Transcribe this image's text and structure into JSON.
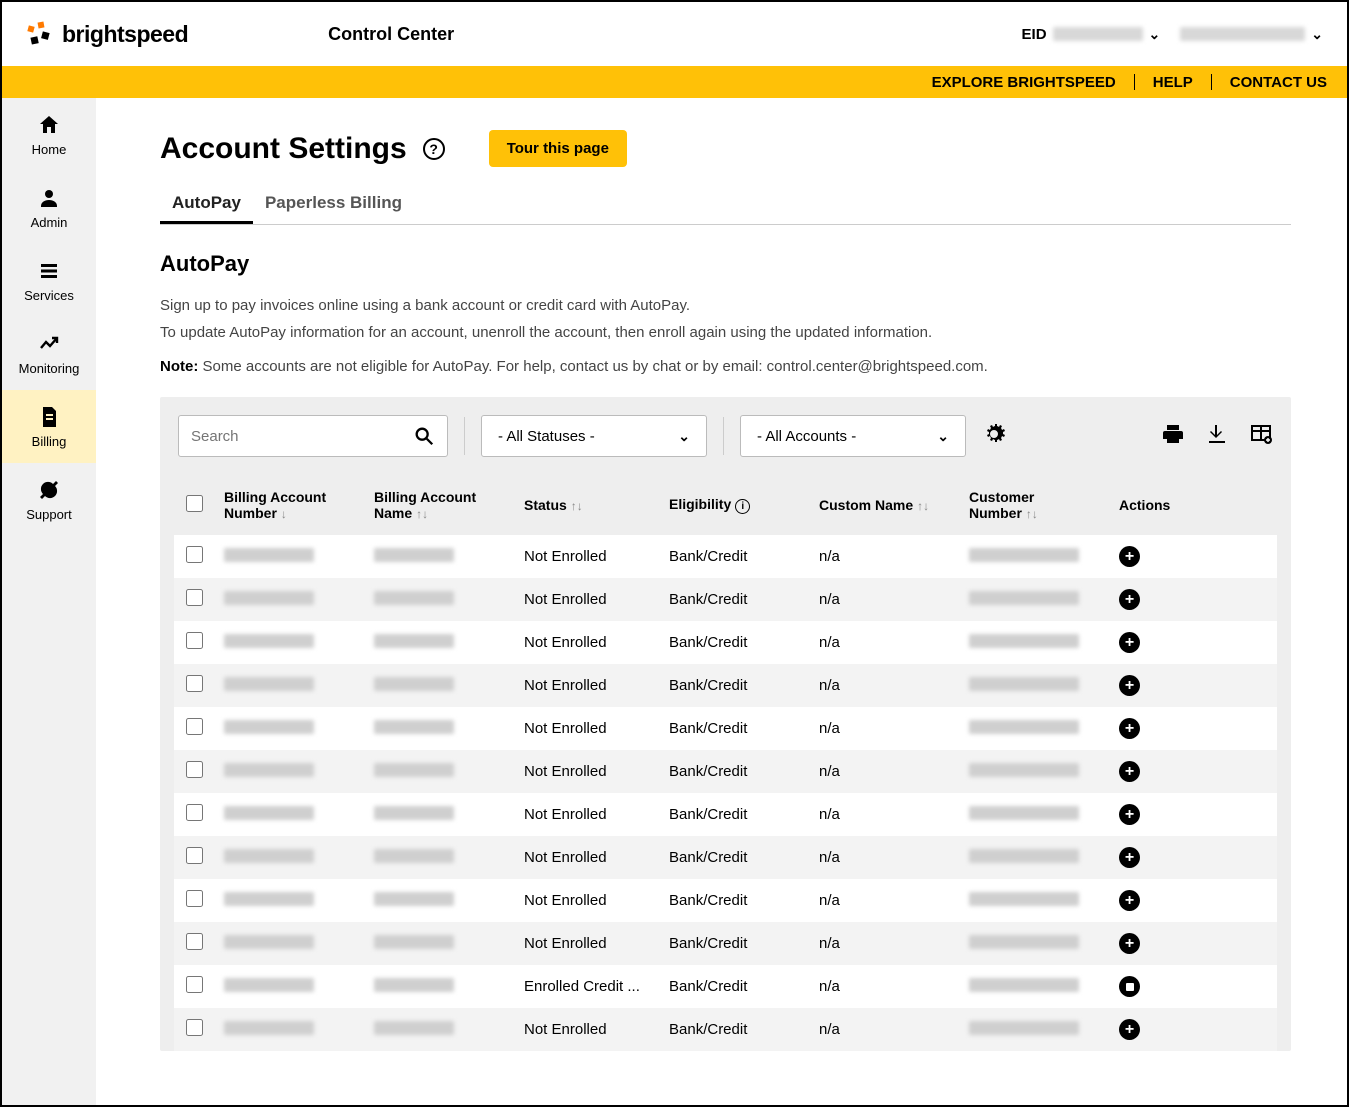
{
  "header": {
    "logo_text": "brightspeed",
    "product": "Control Center",
    "eid_label": "EID"
  },
  "yellowbar": {
    "explore": "EXPLORE BRIGHTSPEED",
    "help": "HELP",
    "contact": "CONTACT US"
  },
  "sidebar": {
    "items": [
      {
        "key": "home",
        "label": "Home"
      },
      {
        "key": "admin",
        "label": "Admin"
      },
      {
        "key": "services",
        "label": "Services"
      },
      {
        "key": "monitoring",
        "label": "Monitoring"
      },
      {
        "key": "billing",
        "label": "Billing"
      },
      {
        "key": "support",
        "label": "Support"
      }
    ]
  },
  "page": {
    "title": "Account Settings",
    "tour_btn": "Tour this page",
    "tabs": {
      "autopay": "AutoPay",
      "paperless": "Paperless Billing"
    },
    "section_title": "AutoPay",
    "desc1": "Sign up to pay invoices online using a bank account or credit card with AutoPay.",
    "desc2": "To update AutoPay information for an account, unenroll the account, then enroll again using the updated information.",
    "note_label": "Note:",
    "note_text": " Some accounts are not eligible for AutoPay. For help, contact us by chat or by email: control.center@brightspeed.com."
  },
  "controls": {
    "search_placeholder": "Search",
    "status_filter": "- All Statuses -",
    "account_filter": "- All Accounts -"
  },
  "columns": {
    "ban": "Billing Account Number",
    "name": "Billing Account Name",
    "status": "Status",
    "elig": "Eligibility",
    "custom": "Custom Name",
    "cust_num": "Customer Number",
    "actions": "Actions"
  },
  "rows": [
    {
      "status": "Not Enrolled",
      "elig": "Bank/Credit",
      "custom": "n/a",
      "action": "plus"
    },
    {
      "status": "Not Enrolled",
      "elig": "Bank/Credit",
      "custom": "n/a",
      "action": "plus"
    },
    {
      "status": "Not Enrolled",
      "elig": "Bank/Credit",
      "custom": "n/a",
      "action": "plus"
    },
    {
      "status": "Not Enrolled",
      "elig": "Bank/Credit",
      "custom": "n/a",
      "action": "plus"
    },
    {
      "status": "Not Enrolled",
      "elig": "Bank/Credit",
      "custom": "n/a",
      "action": "plus"
    },
    {
      "status": "Not Enrolled",
      "elig": "Bank/Credit",
      "custom": "n/a",
      "action": "plus"
    },
    {
      "status": "Not Enrolled",
      "elig": "Bank/Credit",
      "custom": "n/a",
      "action": "plus"
    },
    {
      "status": "Not Enrolled",
      "elig": "Bank/Credit",
      "custom": "n/a",
      "action": "plus"
    },
    {
      "status": "Not Enrolled",
      "elig": "Bank/Credit",
      "custom": "n/a",
      "action": "plus"
    },
    {
      "status": "Not Enrolled",
      "elig": "Bank/Credit",
      "custom": "n/a",
      "action": "plus"
    },
    {
      "status": "Enrolled Credit ...",
      "elig": "Bank/Credit",
      "custom": "n/a",
      "action": "stop"
    },
    {
      "status": "Not Enrolled",
      "elig": "Bank/Credit",
      "custom": "n/a",
      "action": "plus"
    }
  ]
}
